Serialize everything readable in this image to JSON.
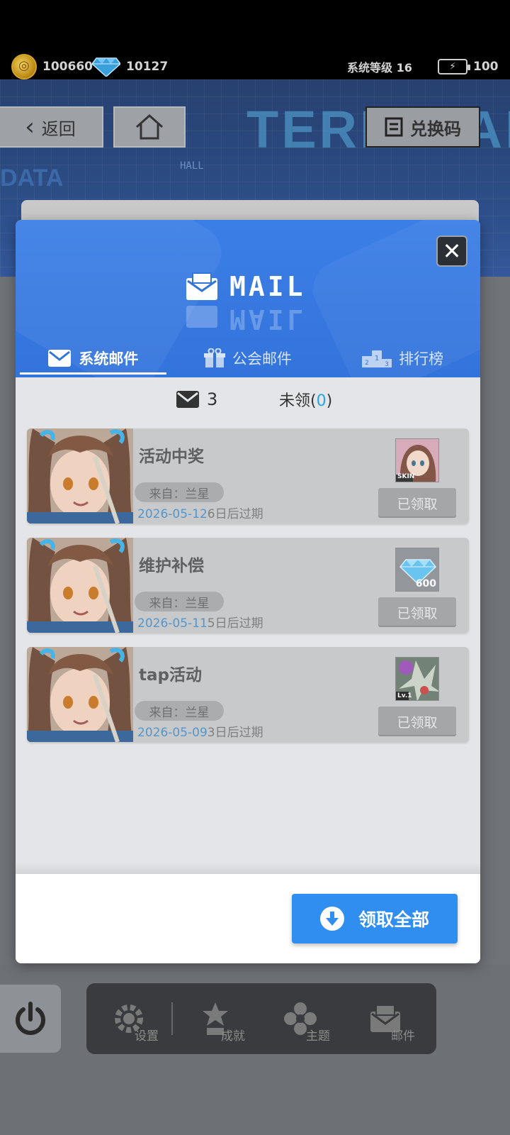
{
  "top_bar": {
    "coins": "100660",
    "gems": "10127",
    "system_level": "系统等级 16",
    "energy": "100"
  },
  "background": {
    "back_label": "返回",
    "redeem_label": "兑换码",
    "banner_text": "TERMINAL",
    "data_text": "DATA",
    "hall_text": "HALL"
  },
  "modal": {
    "title": "MAIL",
    "tabs": [
      {
        "label": "系统邮件",
        "icon": "envelope-icon",
        "active": true
      },
      {
        "label": "公会邮件",
        "icon": "gift-icon",
        "active": false
      },
      {
        "label": "排行榜",
        "icon": "podium-icon",
        "active": false
      }
    ],
    "mail_count": "3",
    "unclaimed_prefix": "未领(",
    "unclaimed_count": "0",
    "unclaimed_suffix": ")",
    "mails": [
      {
        "title": "活动中奖",
        "from": "来自：兰星",
        "date": "2026-05-12",
        "expiry": "6日后过期",
        "reward": "skin-reward-icon",
        "reward_label": "SKIN",
        "status": "已领取"
      },
      {
        "title": "维护补偿",
        "from": "来自：兰星",
        "date": "2026-05-11",
        "expiry": "5日后过期",
        "reward": "diamond-reward-icon",
        "reward_label": "600",
        "status": "已领取"
      },
      {
        "title": "tap活动",
        "from": "来自：兰星",
        "date": "2026-05-09",
        "expiry": "3日后过期",
        "reward": "item-reward-icon",
        "reward_label": "Lv.1",
        "status": "已领取"
      }
    ],
    "claim_all_label": "领取全部"
  },
  "dock": {
    "items": [
      {
        "label": "设置",
        "icon": "settings-icon"
      },
      {
        "label": "成就",
        "icon": "achievement-icon"
      },
      {
        "label": "主题",
        "icon": "theme-icon"
      },
      {
        "label": "邮件",
        "icon": "mail-icon"
      }
    ]
  },
  "colors": {
    "modal_header": "#3373dc",
    "accent": "#2f8ef0",
    "unclaimed_zero": "#29a3e6",
    "date": "#4a90c8"
  }
}
